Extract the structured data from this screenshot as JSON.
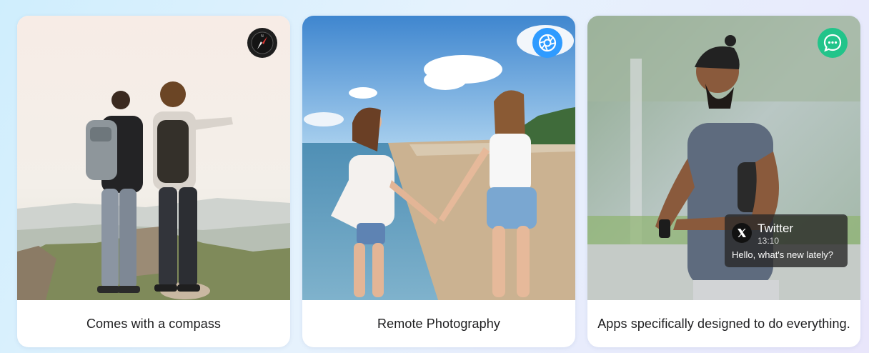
{
  "cards": [
    {
      "caption": "Comes with a compass",
      "badge_icon": "compass-icon",
      "badge_color": "#1e1e1e"
    },
    {
      "caption": "Remote Photography",
      "badge_icon": "camera-shutter-icon",
      "badge_color": "#2f9bff"
    },
    {
      "caption": "Apps specifically designed to do everything.",
      "badge_icon": "chat-bubble-icon",
      "badge_color": "#22c48a"
    }
  ],
  "notification": {
    "app_icon": "x-logo-icon",
    "title": "Twitter",
    "time": "13:10",
    "message": "Hello, what's new lately?"
  }
}
